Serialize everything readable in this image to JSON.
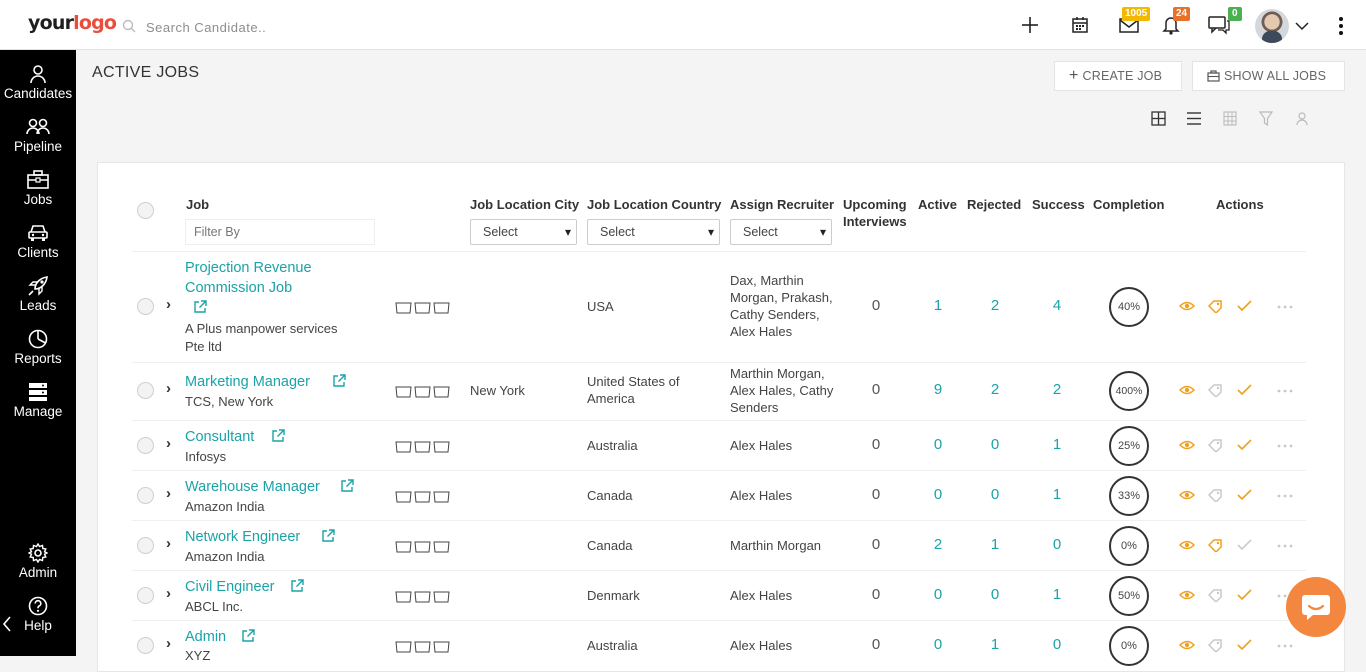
{
  "topbar": {
    "logo_part1": "your",
    "logo_part2": "logo",
    "search_placeholder": "Search Candidate..",
    "badges": {
      "mail": "1005",
      "notifications": "24",
      "chat": "0"
    },
    "badge_colors": {
      "mail": "#f5b800",
      "notifications": "#e8702b",
      "chat": "#4caf50"
    }
  },
  "sidebar": {
    "items": [
      {
        "label": "Candidates",
        "icon": "user-icon"
      },
      {
        "label": "Pipeline",
        "icon": "users-icon"
      },
      {
        "label": "Jobs",
        "icon": "briefcase-icon"
      },
      {
        "label": "Clients",
        "icon": "car-icon"
      },
      {
        "label": "Leads",
        "icon": "rocket-icon"
      },
      {
        "label": "Reports",
        "icon": "pie-chart-icon"
      },
      {
        "label": "Manage",
        "icon": "server-icon"
      }
    ],
    "bottom_items": [
      {
        "label": "Admin",
        "icon": "gear-icon"
      },
      {
        "label": "Help",
        "icon": "help-circle-icon"
      }
    ]
  },
  "page": {
    "title": "ACTIVE JOBS",
    "create_job": "CREATE JOB",
    "show_all_jobs": "SHOW ALL JOBS"
  },
  "table": {
    "headers": {
      "job": "Job",
      "city": "Job Location City",
      "country": "Job Location Country",
      "recruiter": "Assign Recruiter",
      "upcoming1": "Upcoming",
      "upcoming2": "Interviews",
      "active": "Active",
      "rejected": "Rejected",
      "success": "Success",
      "completion": "Completion",
      "actions": "Actions"
    },
    "filter_placeholder": "Filter By",
    "select_label": "Select",
    "rows": [
      {
        "title1": "Projection Revenue",
        "title2": "Commission Job",
        "company1": "A Plus manpower services",
        "company2": "Pte ltd",
        "city": "",
        "country1": "USA",
        "country2": "",
        "recruiter1": "Dax, Marthin",
        "recruiter2": "Morgan, Prakash,",
        "recruiter3": "Cathy Senders,",
        "recruiter4": "Alex Hales",
        "upcoming": "0",
        "active": "1",
        "rejected": "2",
        "success": "4",
        "completion": "40%"
      },
      {
        "title1": "Marketing Manager",
        "company1": "TCS, New York",
        "city": "New York",
        "country1": "United States of",
        "country2": "America",
        "recruiter1": "Marthin Morgan,",
        "recruiter2": "Alex Hales, Cathy",
        "recruiter3": "Senders",
        "upcoming": "0",
        "active": "9",
        "rejected": "2",
        "success": "2",
        "completion": "400%"
      },
      {
        "title1": "Consultant",
        "company1": "Infosys",
        "city": "",
        "country1": "Australia",
        "recruiter1": "Alex Hales",
        "upcoming": "0",
        "active": "0",
        "rejected": "0",
        "success": "1",
        "completion": "25%"
      },
      {
        "title1": "Warehouse Manager",
        "company1": "Amazon India",
        "city": "",
        "country1": "Canada",
        "recruiter1": "Alex Hales",
        "upcoming": "0",
        "active": "0",
        "rejected": "0",
        "success": "1",
        "completion": "33%"
      },
      {
        "title1": "Network Engineer",
        "company1": "Amazon India",
        "city": "",
        "country1": "Canada",
        "recruiter1": "Marthin Morgan",
        "upcoming": "0",
        "active": "2",
        "rejected": "1",
        "success": "0",
        "completion": "0%"
      },
      {
        "title1": "Civil Engineer",
        "company1": "ABCL Inc.",
        "city": "",
        "country1": "Denmark",
        "recruiter1": "Alex Hales",
        "upcoming": "0",
        "active": "0",
        "rejected": "0",
        "success": "1",
        "completion": "50%"
      },
      {
        "title1": "Admin",
        "company1": "XYZ",
        "city": "",
        "country1": "Australia",
        "recruiter1": "Alex Hales",
        "upcoming": "0",
        "active": "0",
        "rejected": "1",
        "success": "0",
        "completion": "0%"
      }
    ]
  },
  "colors": {
    "teal": "#1aa3a8",
    "orange": "#f4873f",
    "action_orange": "#f0a020"
  }
}
